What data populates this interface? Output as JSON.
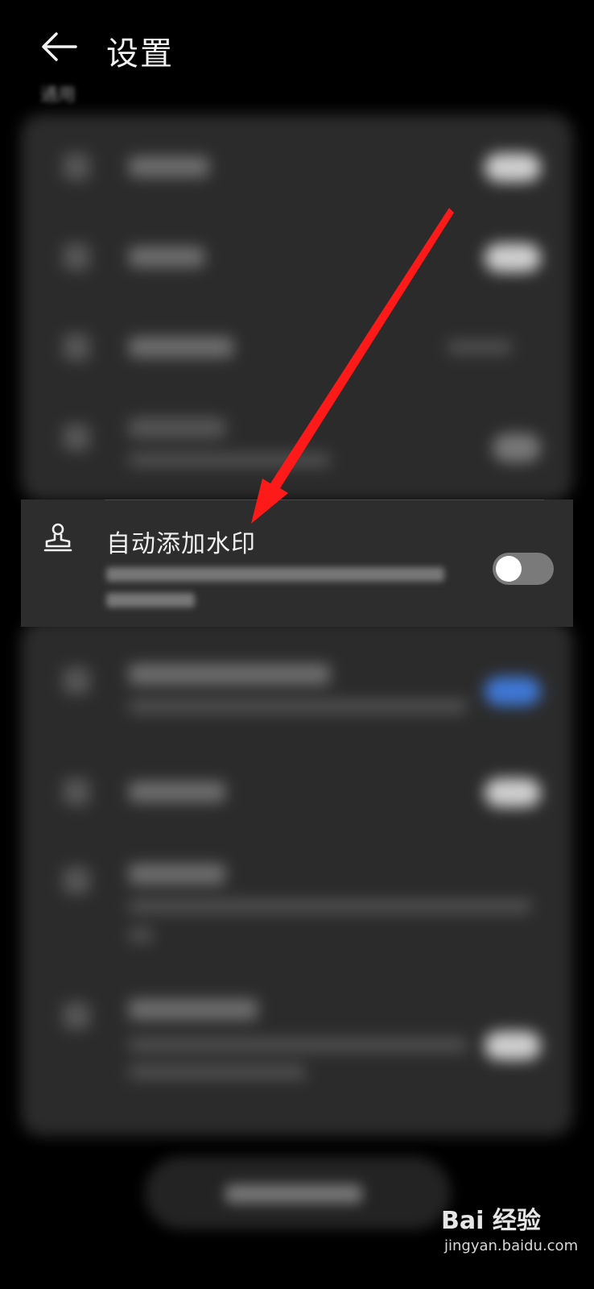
{
  "header": {
    "title": "设置",
    "section_hint": "通用"
  },
  "focused_item": {
    "title": "自动添加水印",
    "toggle_state": "off"
  },
  "icons": {
    "back": "back-arrow-icon",
    "stamp": "stamp-icon"
  },
  "colors": {
    "background": "#000000",
    "card": "#2b2b2b",
    "arrow": "#ff1a1a",
    "toggle_off": "#7a7a7a",
    "toggle_on": "#3f78d6"
  },
  "watermark": {
    "brand": "Bai 经验",
    "url": "jingyan.baidu.com"
  }
}
